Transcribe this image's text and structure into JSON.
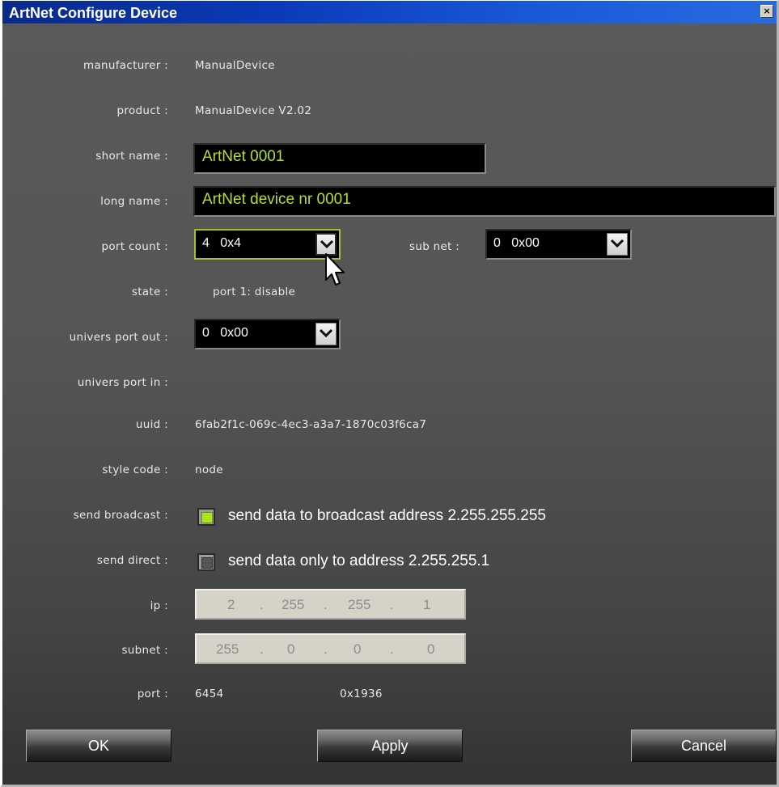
{
  "window": {
    "title": "ArtNet Configure Device",
    "close_label": "×"
  },
  "fields": {
    "manufacturer": {
      "label": "manufacturer :",
      "value": "ManualDevice"
    },
    "product": {
      "label": "product :",
      "value": "ManualDevice V2.02"
    },
    "short_name": {
      "label": "short name :",
      "value": "ArtNet 0001"
    },
    "long_name": {
      "label": "long name :",
      "value": "ArtNet device nr 0001"
    },
    "port_count": {
      "label": "port count :",
      "value": "4   0x4"
    },
    "sub_net": {
      "label": "sub net :",
      "value": "0   0x00"
    },
    "state": {
      "label": "state :",
      "value": "port 1: disable"
    },
    "univers_port_out": {
      "label": "univers port out :",
      "value": "0   0x00"
    },
    "univers_port_in": {
      "label": "univers port in :"
    },
    "uuid": {
      "label": "uuid :",
      "value": "6fab2f1c-069c-4ec3-a3a7-1870c03f6ca7"
    },
    "style_code": {
      "label": "style code :",
      "value": "node"
    },
    "send_broadcast": {
      "label": "send broadcast :",
      "text": "send data to broadcast address 2.255.255.255",
      "checked": true
    },
    "send_direct": {
      "label": "send direct :",
      "text": "send data only to address 2.255.255.1",
      "checked": false
    },
    "ip": {
      "label": "ip :",
      "octets": [
        "2",
        "255",
        "255",
        "1"
      ]
    },
    "subnet": {
      "label": "subnet :",
      "octets": [
        "255",
        "0",
        "0",
        "0"
      ]
    },
    "port": {
      "label": "port :",
      "decimal": "6454",
      "hex": "0x1936"
    }
  },
  "ip_separator": ".",
  "buttons": {
    "ok": "OK",
    "apply": "Apply",
    "cancel": "Cancel"
  },
  "colors": {
    "accent": "#b9e020",
    "title_bar": "#0b3ab8",
    "panel": "#5a5a5a"
  }
}
